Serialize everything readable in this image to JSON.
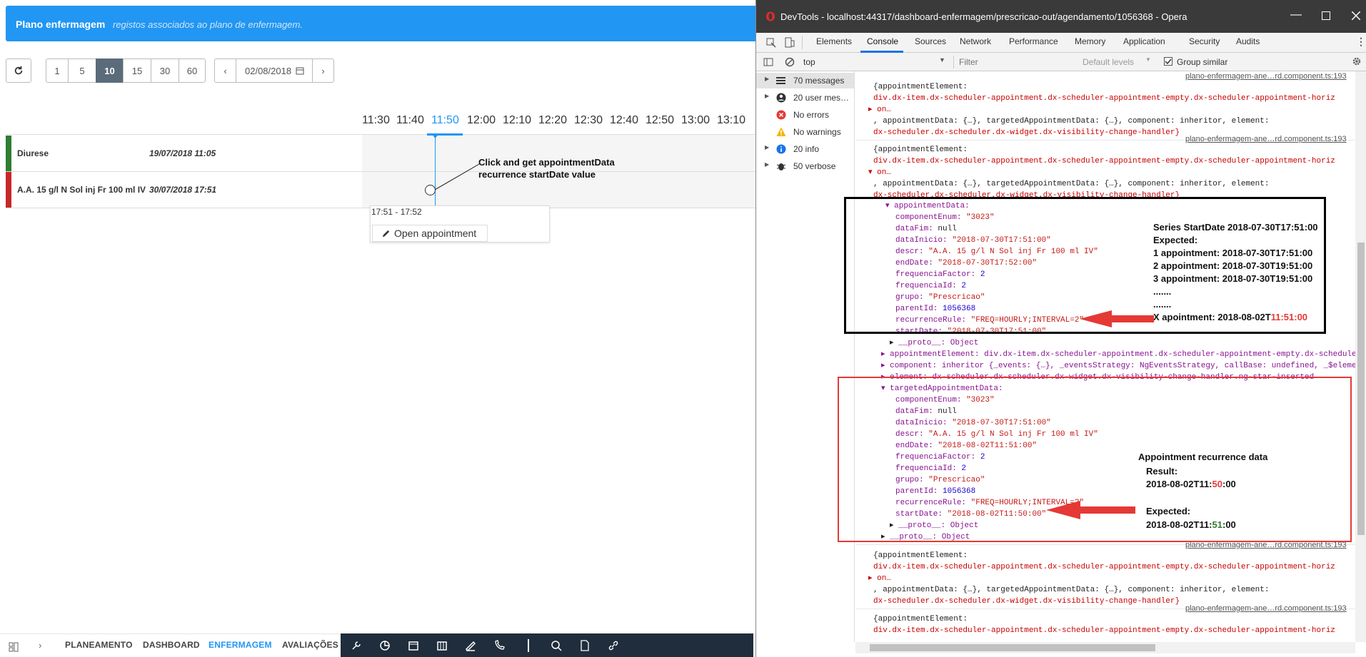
{
  "banner": {
    "title": "Plano enfermagem",
    "subtitle": "registos associados ao plano de enfermagem."
  },
  "toolbar": {
    "pages": [
      "1",
      "5",
      "10",
      "15",
      "30",
      "60"
    ],
    "selected_page": "10",
    "date": "02/08/2018"
  },
  "timeline": {
    "hours": [
      "11:30",
      "11:40",
      "11:50",
      "12:00",
      "12:10",
      "12:20",
      "12:30",
      "12:40",
      "12:50",
      "13:00",
      "13:10"
    ],
    "current": "11:50"
  },
  "rows": [
    {
      "label": "Diurese",
      "date": "19/07/2018 11:05",
      "color": "#2e7d32"
    },
    {
      "label": "A.A. 15 g/l N Sol inj Fr 100 ml IV",
      "date": "30/07/2018 17:51",
      "color": "#c62828"
    }
  ],
  "annotation_note": {
    "line1": "Click and get appointmentData",
    "line2": "recurrence startDate value"
  },
  "tooltip": {
    "time": "17:51 - 17:52",
    "button": "Open appointment"
  },
  "bottom_nav": [
    "PLANEAMENTO",
    "DASHBOARD",
    "ENFERMAGEM",
    "AVALIAÇÕES"
  ],
  "bottom_nav_active": "ENFERMAGEM",
  "devtools": {
    "title": "DevTools - localhost:44317/dashboard-enfermagem/prescricao-out/agendamento/1056368 - Opera",
    "tabs": [
      "Elements",
      "Console",
      "Sources",
      "Network",
      "Performance",
      "Memory",
      "Application",
      "Security",
      "Audits"
    ],
    "active_tab": "Console",
    "context": "top",
    "filter_placeholder": "Filter",
    "levels": "Default levels",
    "group_similar": "Group similar",
    "sidebar": [
      "70 messages",
      "20 user mes…",
      "No errors",
      "No warnings",
      "20 info",
      "50 verbose"
    ],
    "source_link": "plano-enfermagem-ane…rd.component.ts:193",
    "log_header": "{appointmentElement:",
    "log_class": "div.dx-item.dx-scheduler-appointment.dx-scheduler-appointment-empty.dx-scheduler-appointment-horiz",
    "log_on": "on…",
    "log_mid": ", appointmentData: {…}, targetedAppointmentData: {…}, component: inheritor, element:",
    "log_el": "dx-scheduler.dx-scheduler.dx-widget.dx-visibility-change-handler}",
    "appointmentData": {
      "header": "appointmentData:",
      "lines": [
        [
          "componentEnum: ",
          "\"3023\""
        ],
        [
          "dataFim: ",
          "null"
        ],
        [
          "dataInicio: ",
          "\"2018-07-30T17:51:00\""
        ],
        [
          "descr: ",
          "\"A.A. 15 g/l N Sol inj Fr 100 ml IV\""
        ],
        [
          "endDate: ",
          "\"2018-07-30T17:52:00\""
        ],
        [
          "frequenciaFactor: ",
          "2"
        ],
        [
          "frequenciaId: ",
          "2"
        ],
        [
          "grupo: ",
          "\"Prescricao\""
        ],
        [
          "parentId: ",
          "1056368"
        ],
        [
          "recurrenceRule: ",
          "\"FREQ=HOURLY;INTERVAL=2\""
        ],
        [
          "startDate: ",
          "\"2018-07-30T17:51:00\""
        ]
      ],
      "proto": "__proto__: Object"
    },
    "middle_lines": [
      "appointmentElement: div.dx-item.dx-scheduler-appointment.dx-scheduler-appointment-empty.dx-scheduler-appointment-horiz",
      "component: inheritor {_events: {…}, _eventsStrategy: NgEventsStrategy, callBase: undefined, _$element",
      "element: dx-scheduler.dx-scheduler.dx-widget.dx-visibility-change-handler.ng-star-inserted"
    ],
    "targetedAppointmentData": {
      "header": "targetedAppointmentData:",
      "lines": [
        [
          "componentEnum: ",
          "\"3023\""
        ],
        [
          "dataFim: ",
          "null"
        ],
        [
          "dataInicio: ",
          "\"2018-07-30T17:51:00\""
        ],
        [
          "descr: ",
          "\"A.A. 15 g/l N Sol inj Fr 100 ml IV\""
        ],
        [
          "endDate: ",
          "\"2018-08-02T11:51:00\""
        ],
        [
          "frequenciaFactor: ",
          "2"
        ],
        [
          "frequenciaId: ",
          "2"
        ],
        [
          "grupo: ",
          "\"Prescricao\""
        ],
        [
          "parentId: ",
          "1056368"
        ],
        [
          "recurrenceRule: ",
          "\"FREQ=HOURLY;INTERVAL=2\""
        ],
        [
          "startDate: ",
          "\"2018-08-02T11:50:00\""
        ]
      ],
      "proto": "__proto__: Object",
      "proto2": "__proto__: Object"
    },
    "series_annotation": {
      "l1": "Series StartDate 2018-07-30T17:51:00",
      "l2": "Expected:",
      "l3": "1 appointment: 2018-07-30T17:51:00",
      "l4": "2 appointment: 2018-07-30T19:51:00",
      "l5": "3 appointment: 2018-07-30T19:51:00",
      "l6": ".......",
      "l7": ".......",
      "l8a": "X apointment: 2018-08-02T",
      "l8b": "11:51:00"
    },
    "result_annotation": {
      "title": "Appointment  recurrence data",
      "result": "Result:",
      "r_a": "2018-08-02T11:",
      "r_b": "50",
      "r_c": ":00",
      "expected": "Expected:",
      "e_a": "2018-08-02T11:",
      "e_b": "51",
      "e_c": ":00"
    },
    "colors": {
      "red_box": "#e53935",
      "black_box": "#000000",
      "arrow": "#e53935",
      "result_red": "#e53935",
      "expected_green": "#2e7d32"
    }
  }
}
